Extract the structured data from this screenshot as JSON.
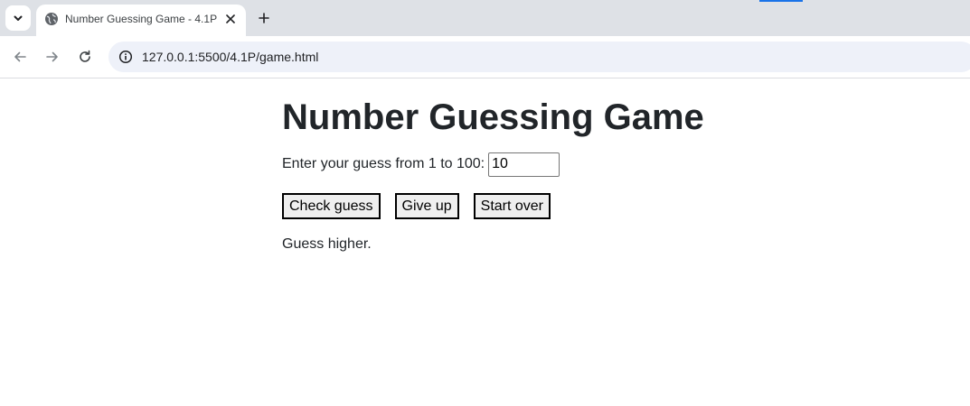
{
  "browser": {
    "tab": {
      "title": "Number Guessing Game - 4.1P",
      "favicon": "globe-icon"
    },
    "icons": {
      "tab_search": "chevron-down-icon",
      "close_tab": "close-icon",
      "new_tab": "plus-icon",
      "back": "arrow-left-icon",
      "forward": "arrow-right-icon",
      "reload": "reload-icon",
      "site_info": "info-icon"
    },
    "address_bar": {
      "url": "127.0.0.1:5500/4.1P/game.html"
    },
    "colors": {
      "tab_strip": "#dee1e6",
      "omnibox": "#eef1f9",
      "accent": "#1a73e8"
    }
  },
  "page": {
    "title": "Number Guessing Game",
    "guess_prompt": "Enter your guess from 1 to 100:",
    "guess_value": "10",
    "buttons": {
      "check": "Check guess",
      "give_up": "Give up",
      "start_over": "Start over"
    },
    "message": "Guess higher."
  }
}
